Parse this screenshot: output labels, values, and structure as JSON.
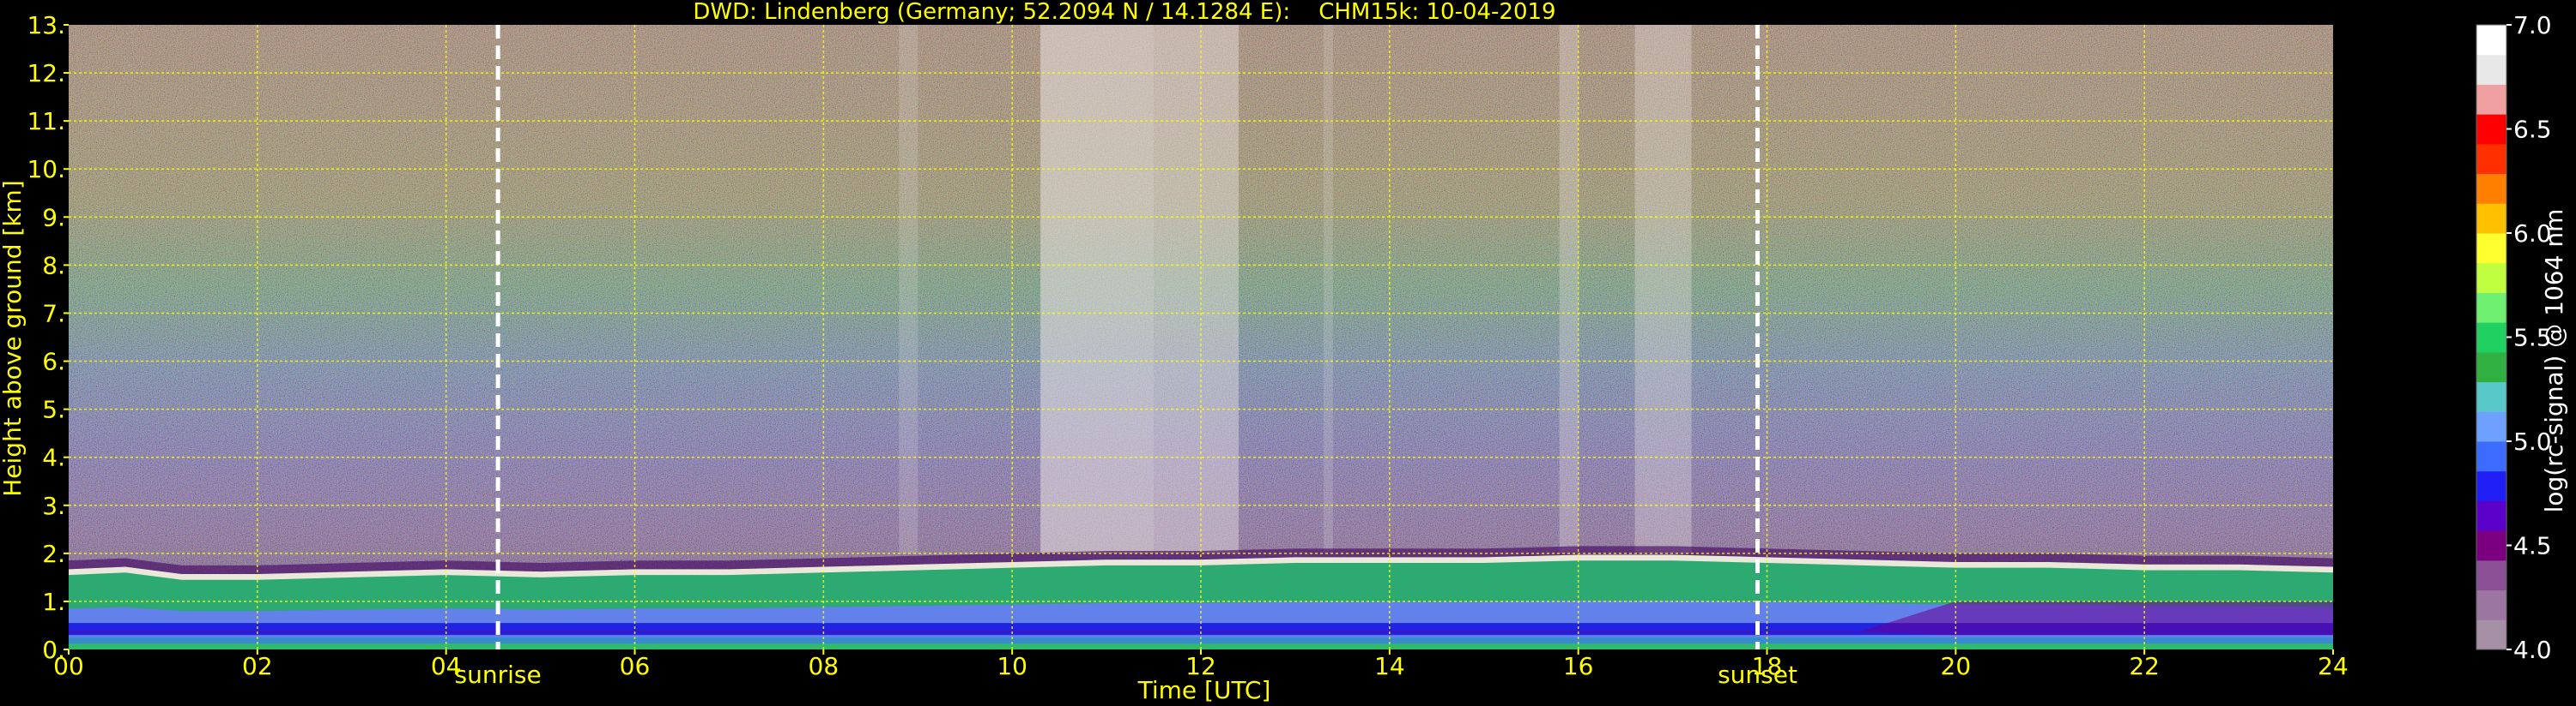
{
  "chart_data": {
    "type": "heatmap",
    "title": "DWD: Lindenberg (Germany; 52.2094 N / 14.1284 E):    CHM15k: 10-04-2019",
    "xlabel": "Time [UTC]",
    "ylabel": "Height above ground [km]",
    "xlim": [
      0,
      24
    ],
    "ylim": [
      0,
      13
    ],
    "x_ticks": [
      0,
      2,
      4,
      6,
      8,
      10,
      12,
      14,
      16,
      18,
      20,
      22,
      24
    ],
    "x_tick_labels": [
      "00",
      "02",
      "04",
      "06",
      "08",
      "10",
      "12",
      "14",
      "16",
      "18",
      "20",
      "22",
      "24"
    ],
    "y_ticks": [
      0,
      1,
      2,
      3,
      4,
      5,
      6,
      7,
      8,
      9,
      10,
      11,
      12,
      13
    ],
    "y_tick_labels": [
      "0.",
      "1.",
      "2.",
      "3.",
      "4.",
      "5.",
      "6.",
      "7.",
      "8.",
      "9.",
      "10.",
      "11.",
      "12.",
      "13."
    ],
    "grid": true,
    "grid_color": "#ffff00",
    "text_color": "#ffff00",
    "background": "#000000",
    "annotations": [
      {
        "label": "sunrise",
        "x": 4.55
      },
      {
        "label": "sunset",
        "x": 17.9
      }
    ],
    "boundary_layer_top": [
      [
        0.0,
        1.55
      ],
      [
        0.6,
        1.6
      ],
      [
        1.2,
        1.45
      ],
      [
        2.0,
        1.45
      ],
      [
        3.0,
        1.5
      ],
      [
        4.0,
        1.55
      ],
      [
        5.0,
        1.5
      ],
      [
        6.0,
        1.55
      ],
      [
        7.0,
        1.55
      ],
      [
        8.0,
        1.6
      ],
      [
        9.0,
        1.65
      ],
      [
        10.0,
        1.7
      ],
      [
        11.0,
        1.75
      ],
      [
        12.0,
        1.75
      ],
      [
        13.0,
        1.8
      ],
      [
        14.0,
        1.8
      ],
      [
        15.0,
        1.8
      ],
      [
        16.0,
        1.85
      ],
      [
        17.0,
        1.85
      ],
      [
        18.0,
        1.8
      ],
      [
        19.0,
        1.75
      ],
      [
        20.0,
        1.7
      ],
      [
        21.0,
        1.7
      ],
      [
        22.0,
        1.65
      ],
      [
        23.0,
        1.65
      ],
      [
        24.0,
        1.6
      ]
    ],
    "colorbar": {
      "label": "log(rc-signal) @ 1064 nm",
      "range": [
        4.0,
        7.0
      ],
      "ticks": [
        4.0,
        4.5,
        5.0,
        5.5,
        6.0,
        6.5,
        7.0
      ],
      "tick_labels": [
        "4.0",
        "4.5",
        "5.0",
        "5.5",
        "6.0",
        "6.5",
        "7.0"
      ],
      "colors": [
        "#a590a5",
        "#9b76a0",
        "#8a4f95",
        "#7a0080",
        "#5a00c8",
        "#1f1ff5",
        "#3c6cff",
        "#6ea0ff",
        "#58c8c8",
        "#30b040",
        "#20d060",
        "#70f070",
        "#c0ff40",
        "#ffff30",
        "#ffc000",
        "#ff8000",
        "#ff3000",
        "#ff0000",
        "#f0a0a0",
        "#e8e8e8",
        "#ffffff"
      ]
    }
  }
}
